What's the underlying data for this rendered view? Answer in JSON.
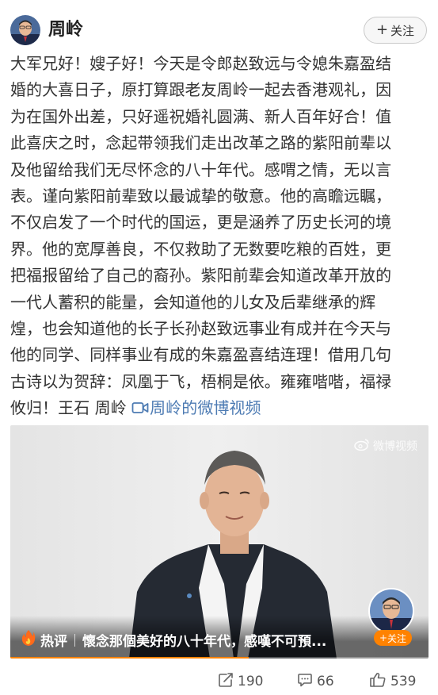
{
  "post": {
    "username": "周岭",
    "follow_label": "关注",
    "text_lines": [
      "大军兄好！嫂子好！今天是令郎赵致远与令媳朱嘉盈结",
      "婚的大喜日子，原打算跟老友周岭一起去香港观礼，因",
      "为在国外出差，只好遥祝婚礼圆满、新人百年好合！值",
      "此喜庆之时，念起带领我们走出改革之路的紫阳前辈以",
      "及他留给我们无尽怀念的八十年代。感喟之情，无以言",
      "表。谨向紫阳前辈致以最诚挚的敬意。他的高瞻远瞩，",
      "不仅启发了一个时代的国运，更是涵养了历史长河的境",
      "界。他的宽厚善良，不仅救助了无数要吃粮的百姓，更",
      "把福报留给了自己的裔孙。紫阳前辈会知道改革开放的",
      "一代人蓄积的能量，会知道他的儿女及后辈继承的辉",
      "煌，也会知道他的长子长孙赵致远事业有成并在今天与",
      "他的同学、同样事业有成的朱嘉盈喜结连理！借用几句",
      "古诗以为贺辞：凤凰于飞，梧桐是依。雍雍喈喈，福禄"
    ],
    "last_line_prefix": "攸归！王石 周岭 ",
    "video_link_label": "周岭的微博视频"
  },
  "video": {
    "watermark": "微博视频",
    "hot_label": "热评",
    "hot_comment": "懷念那個美好的八十年代，感嘆不可預...",
    "mini_follow_label": "关注",
    "progress": 0.57
  },
  "actions": {
    "repost_count": "190",
    "comment_count": "66",
    "like_count": "539"
  },
  "colors": {
    "link": "#4d7bb3",
    "accent_orange": "#ff8200",
    "text": "#333333"
  },
  "icons": {
    "repost": "repost-icon",
    "comment": "comment-icon",
    "like": "like-icon",
    "video_link": "video-camera-icon",
    "hot": "fire-icon"
  }
}
